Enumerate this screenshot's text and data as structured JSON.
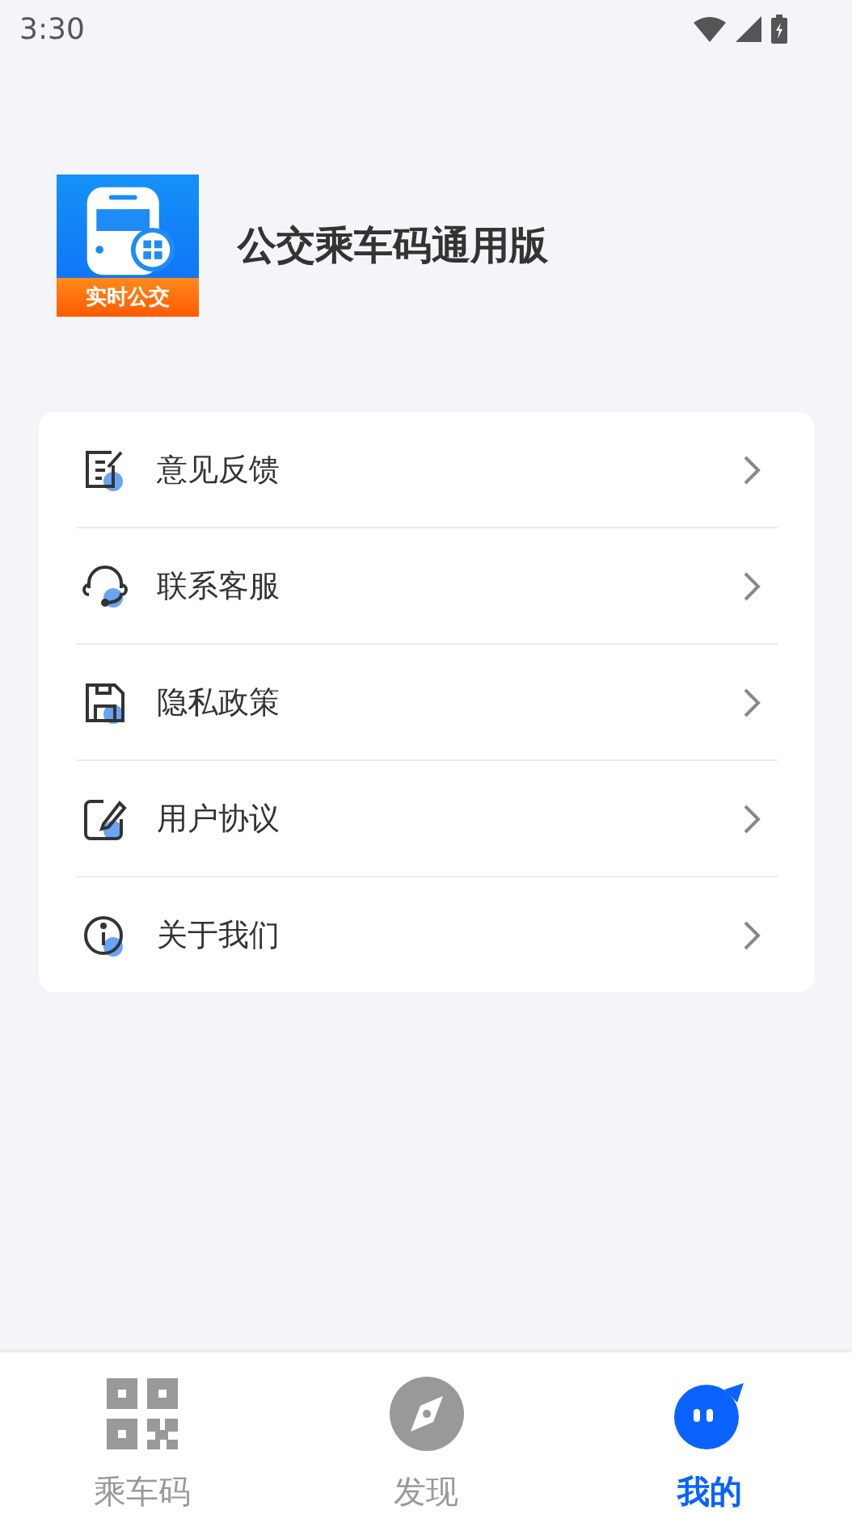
{
  "status_bar": {
    "time": "3:30"
  },
  "app": {
    "badge": "实时公交",
    "name": "公交乘车码通用版"
  },
  "menu": [
    {
      "kind": "feedback",
      "label": "意见反馈"
    },
    {
      "kind": "service",
      "label": "联系客服"
    },
    {
      "kind": "privacy",
      "label": "隐私政策"
    },
    {
      "kind": "agreement",
      "label": "用户协议"
    },
    {
      "kind": "about",
      "label": "关于我们"
    }
  ],
  "tabs": [
    {
      "kind": "qr",
      "label": "乘车码",
      "selected": false
    },
    {
      "kind": "discover",
      "label": "发现",
      "selected": false
    },
    {
      "kind": "mine",
      "label": "我的",
      "selected": true
    }
  ]
}
